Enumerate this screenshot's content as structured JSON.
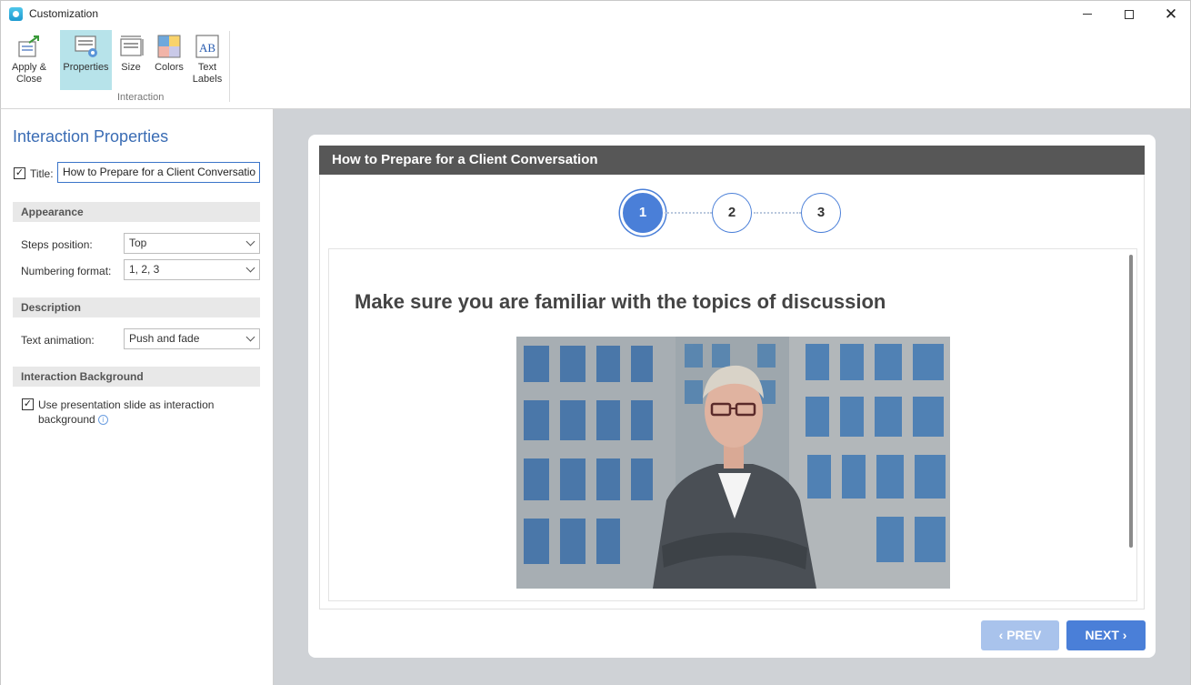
{
  "window": {
    "title": "Customization",
    "minimize_glyph": "",
    "maximize_glyph": "",
    "close_glyph": "✕"
  },
  "ribbon": {
    "apply_close": "Apply & Close",
    "properties": "Properties",
    "size": "Size",
    "colors": "Colors",
    "text_labels": "Text Labels",
    "group_label": "Interaction",
    "selected_tab": "Properties",
    "selected_color": "#b7e3ea"
  },
  "left_panel": {
    "title": "Interaction Properties",
    "title_checkbox": {
      "label": "Title:",
      "checked": true,
      "value": "How to Prepare for a Client Conversatio"
    },
    "appearance": {
      "header": "Appearance",
      "steps_position_label": "Steps position:",
      "steps_position_value": "Top",
      "numbering_format_label": "Numbering format:",
      "numbering_format_value": "1, 2, 3"
    },
    "description": {
      "header": "Description",
      "text_animation_label": "Text animation:",
      "text_animation_value": "Push and fade"
    },
    "background": {
      "header": "Interaction Background",
      "use_slide_label_1": "Use presentation slide as interaction",
      "use_slide_label_2": "background",
      "checked": true
    }
  },
  "preview": {
    "header_title": "How to Prepare for a Client Conversation",
    "steps": [
      "1",
      "2",
      "3"
    ],
    "active_step": "1",
    "accent_color": "#4a7fd8",
    "slide_heading": "Make sure you are familiar with the topics of discussion",
    "prev_label": "PREV",
    "next_label": "NEXT",
    "prev_icon": "‹",
    "next_icon": "›"
  }
}
